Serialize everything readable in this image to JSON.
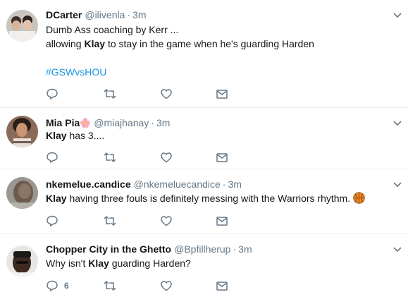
{
  "tweets": [
    {
      "name": "DCarter",
      "handle": "@ilivenla",
      "time": "3m",
      "line1": "Dumb Ass coaching by Kerr ...",
      "line2_pre": "allowing ",
      "line2_bold": "Klay",
      "line2_post": " to stay in the game when he's guarding Harden",
      "hashtag": "#GSWvsHOU",
      "reply_count": ""
    },
    {
      "name": "Mia Pia",
      "handle": "@miajhanay",
      "time": "3m",
      "text_bold": "Klay",
      "text_post": " has 3....",
      "reply_count": ""
    },
    {
      "name": "nkemelue.candice",
      "handle": "@nkemeluecandice",
      "time": "3m",
      "text_bold": "Klay",
      "text_post": " having three fouls is definitely messing with the Warriors rhythm. ",
      "reply_count": ""
    },
    {
      "name": "Chopper City in the Ghetto",
      "handle": "@Bpfillherup",
      "time": "3m",
      "text_pre": "Why isn't ",
      "text_bold": "Klay",
      "text_post": " guarding Harden?",
      "reply_count": "6"
    }
  ],
  "separator": "·",
  "colors": {
    "icon": "#657786",
    "hashtag": "#1b95e0",
    "border": "#e6ecf0"
  },
  "icons": [
    "reply-icon",
    "retweet-icon",
    "like-icon",
    "dm-icon",
    "chevron-down-icon",
    "flower-emoji-icon",
    "basketball-emoji-icon"
  ]
}
